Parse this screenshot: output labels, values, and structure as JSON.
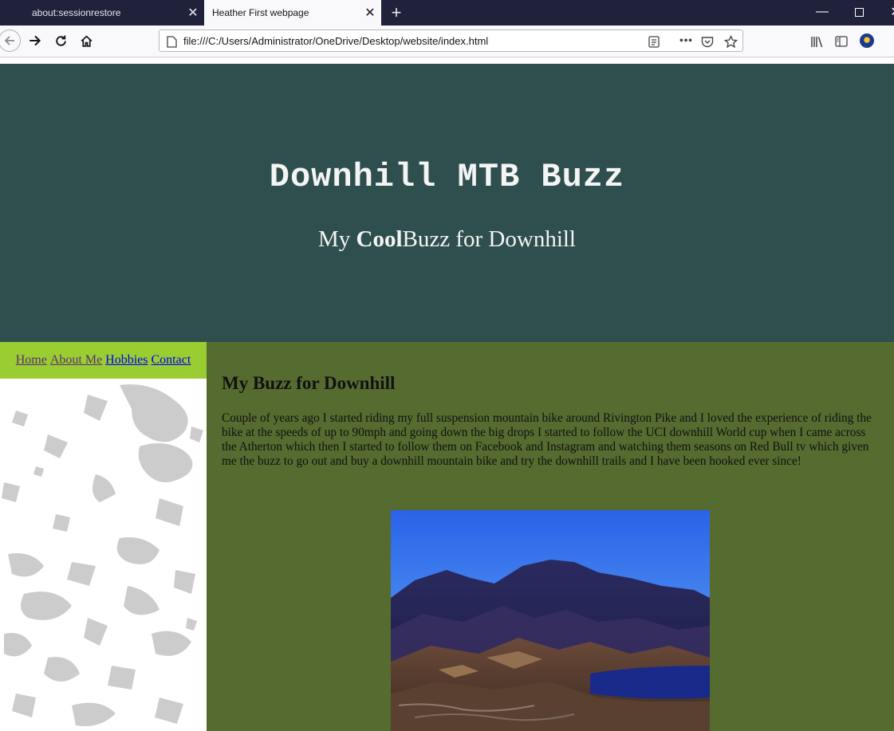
{
  "browser": {
    "tabs": [
      {
        "title": "about:sessionrestore",
        "active": false
      },
      {
        "title": "Heather First webpage",
        "active": true
      }
    ],
    "url": "file:///C:/Users/Administrator/OneDrive/Desktop/website/index.html",
    "icons": [
      "back-icon",
      "forward-icon",
      "reload-icon",
      "home-icon",
      "page-icon",
      "reader-view-icon",
      "more-icon",
      "pocket-icon",
      "bookmark-star-icon",
      "library-icon",
      "sidebar-icon",
      "account-icon",
      "minimize-icon",
      "maximize-icon",
      "close-icon",
      "new-tab-icon"
    ]
  },
  "header": {
    "title": "Downhill MTB Buzz",
    "subtitle_prefix": "My ",
    "subtitle_bold": "Cool",
    "subtitle_suffix": "Buzz for Downhill",
    "background": "#2f4f4f"
  },
  "nav": {
    "home": "Home",
    "about": "About Me",
    "hobbies": "Hobbies",
    "contact": "Contact",
    "background": "#9acd32"
  },
  "main": {
    "heading": "My Buzz for Downhill",
    "paragraph": "Couple of years ago I started riding my full suspension mountain bike around Rivington Pike and I loved the experience of riding the bike at the speeds of up to 90mph and going down the big drops I started to follow the UCI downhill World cup when I came across the Atherton which then I started to follow them on Facebook and Instagram and watching them seasons on Red Bull tv which given me the buzz to go out and buy a downhill mountain bike and try the downhill trails and I have been hooked ever since!",
    "background": "#556b2f"
  }
}
